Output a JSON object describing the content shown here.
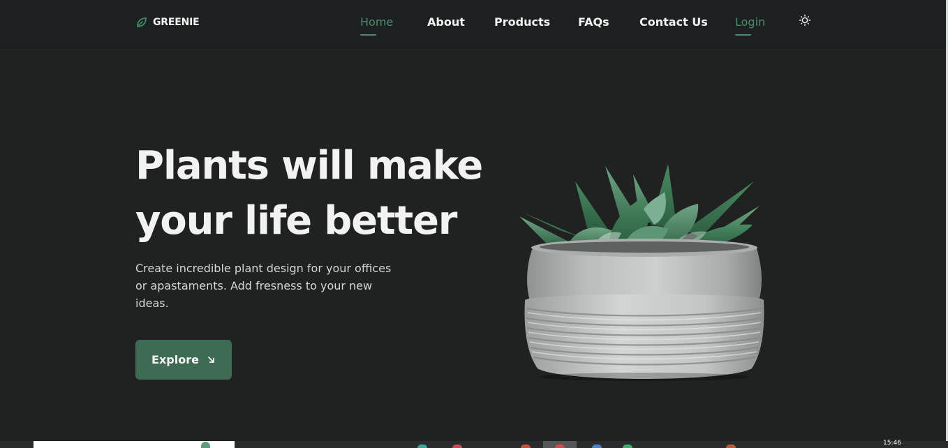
{
  "brand": {
    "name": "GREENIE",
    "icon": "leaf-icon",
    "accent_color": "#4d8a6d"
  },
  "nav": {
    "items": [
      {
        "label": "Home",
        "active": true
      },
      {
        "label": "About",
        "active": false
      },
      {
        "label": "Products",
        "active": false
      },
      {
        "label": "FAQs",
        "active": false
      },
      {
        "label": "Contact Us",
        "active": false
      },
      {
        "label": "Login",
        "active": true
      }
    ],
    "theme_toggle_icon": "sun-icon"
  },
  "hero": {
    "title_line1": "Plants will make",
    "title_line2": "your life better",
    "description": "Create incredible plant design for your offices or apastaments. Add fresness to your new ideas.",
    "cta_label": "Explore",
    "cta_icon": "arrow-down-right-icon",
    "image": "succulent-in-concrete-pot"
  },
  "colors": {
    "background": "#1f2220",
    "header": "#1d2020",
    "button": "#3f6b55",
    "text": "#f2f2f2"
  },
  "taskbar": {
    "time": "15:46"
  }
}
